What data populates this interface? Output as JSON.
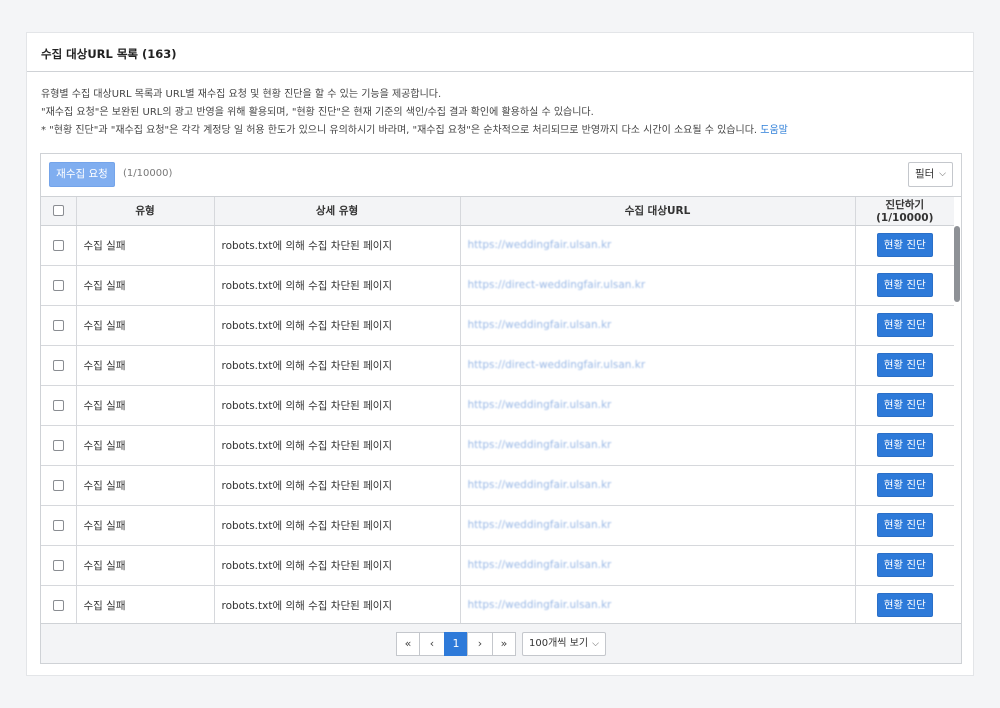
{
  "card": {
    "title": "수집 대상URL 목록 (163)",
    "desc_line1": "유형별 수집 대상URL 목록과 URL별 재수집 요청 및 현황 진단을 할 수 있는 기능을 제공합니다.",
    "desc_line2": "\"재수집 요청\"은 보완된 URL의 광고 반영을 위해 활용되며, \"현황 진단\"은 현재 기준의 색인/수집 결과 확인에 활용하실 수 있습니다.",
    "desc_line3": "* \"현황 진단\"과 \"재수집 요청\"은 각각 계정당 일 허용 한도가 있으니 유의하시기 바라며, \"재수집 요청\"은 순차적으로 처리되므로 반영까지 다소 시간이 소요될 수 있습니다.",
    "help_link": "도움말"
  },
  "toolbar": {
    "recrawl_label": "재수집 요청",
    "recrawl_quota": "(1/10000)",
    "filter_label": "필터"
  },
  "table": {
    "headers": [
      "유형",
      "상세 유형",
      "수집 대상URL",
      "진단하기 (1/10000)"
    ],
    "rows": [
      {
        "type": "수집 실패",
        "detail": "robots.txt에 의해 수집 차단된 페이지",
        "url": "https://weddingfair.ulsan.kr",
        "action": "현황 진단"
      },
      {
        "type": "수집 실패",
        "detail": "robots.txt에 의해 수집 차단된 페이지",
        "url": "https://direct-weddingfair.ulsan.kr",
        "action": "현황 진단"
      },
      {
        "type": "수집 실패",
        "detail": "robots.txt에 의해 수집 차단된 페이지",
        "url": "https://weddingfair.ulsan.kr",
        "action": "현황 진단"
      },
      {
        "type": "수집 실패",
        "detail": "robots.txt에 의해 수집 차단된 페이지",
        "url": "https://direct-weddingfair.ulsan.kr",
        "action": "현황 진단"
      },
      {
        "type": "수집 실패",
        "detail": "robots.txt에 의해 수집 차단된 페이지",
        "url": "https://weddingfair.ulsan.kr",
        "action": "현황 진단"
      },
      {
        "type": "수집 실패",
        "detail": "robots.txt에 의해 수집 차단된 페이지",
        "url": "https://weddingfair.ulsan.kr",
        "action": "현황 진단"
      },
      {
        "type": "수집 실패",
        "detail": "robots.txt에 의해 수집 차단된 페이지",
        "url": "https://weddingfair.ulsan.kr",
        "action": "현황 진단"
      },
      {
        "type": "수집 실패",
        "detail": "robots.txt에 의해 수집 차단된 페이지",
        "url": "https://weddingfair.ulsan.kr",
        "action": "현황 진단"
      },
      {
        "type": "수집 실패",
        "detail": "robots.txt에 의해 수집 차단된 페이지",
        "url": "https://weddingfair.ulsan.kr",
        "action": "현황 진단"
      },
      {
        "type": "수집 실패",
        "detail": "robots.txt에 의해 수집 차단된 페이지",
        "url": "https://weddingfair.ulsan.kr",
        "action": "현황 진단"
      }
    ]
  },
  "pager": {
    "first": "«",
    "prev": "‹",
    "current": "1",
    "next": "›",
    "last": "»",
    "per_page": "100개씩 보기"
  },
  "colors": {
    "primary_button": "#2e7ad9",
    "disabled_button": "#80aef0",
    "link": "#2f7fd8"
  },
  "icons": {
    "filter_chevron": "chevron-down-icon",
    "per_page_chevron": "chevron-down-icon"
  }
}
